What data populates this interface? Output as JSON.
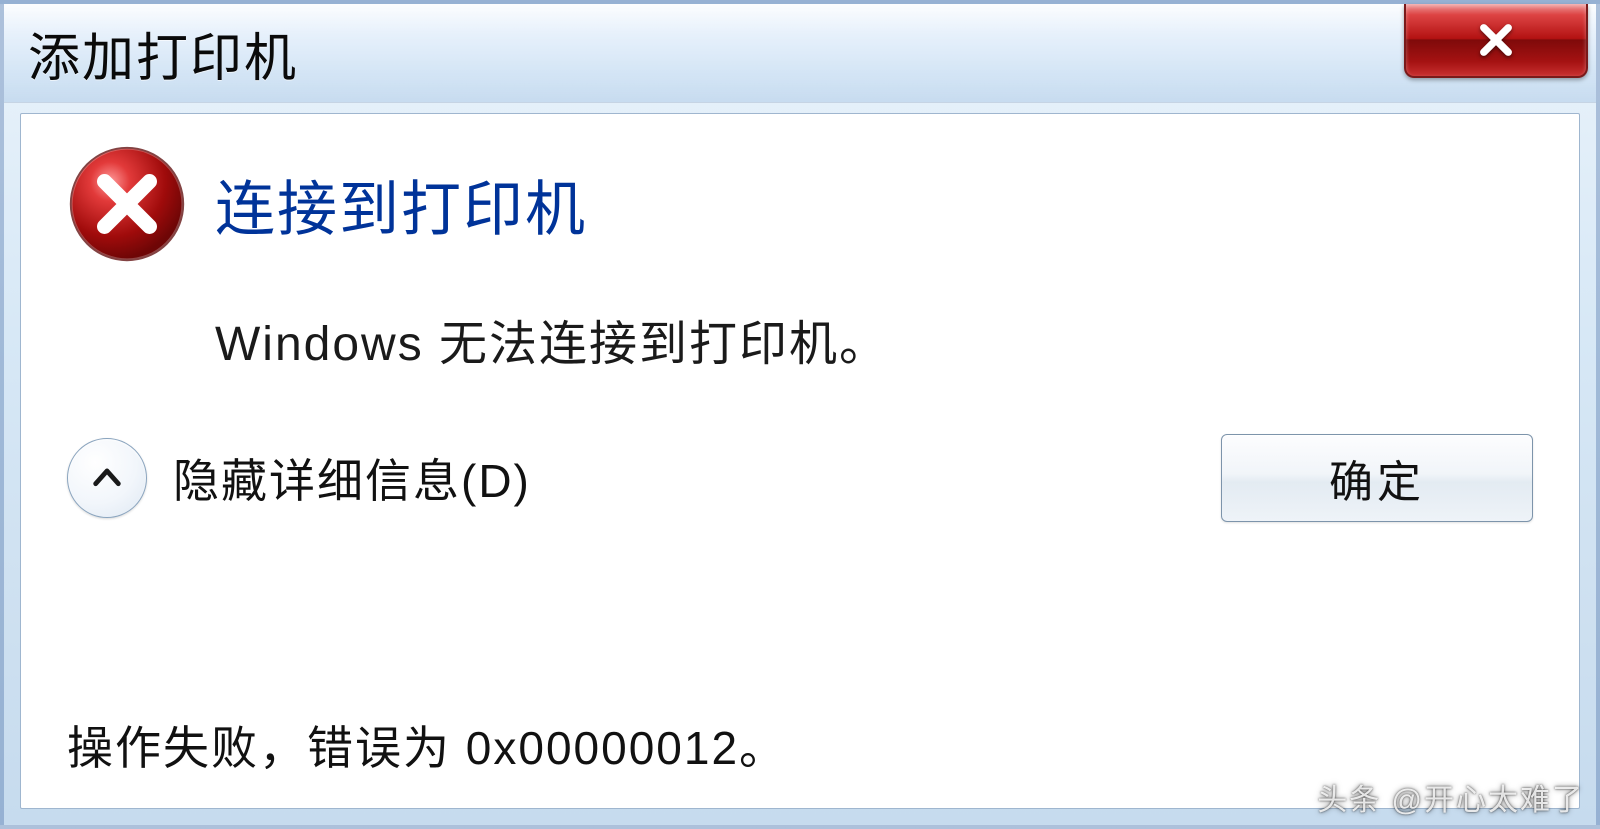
{
  "titlebar": {
    "title": "添加打印机"
  },
  "body": {
    "instruction": "连接到打印机",
    "message": "Windows 无法连接到打印机。",
    "details_toggle_label": "隐藏详细信息(D)",
    "ok_label": "确定",
    "detail_text": "操作失败，错误为 0x00000012。"
  },
  "watermark": "头条 @开心太难了",
  "icons": {
    "error": "error-icon",
    "close": "close-icon",
    "chevron_up": "chevron-up-icon"
  },
  "colors": {
    "instruction": "#003399",
    "close_bg": "#b31212"
  }
}
